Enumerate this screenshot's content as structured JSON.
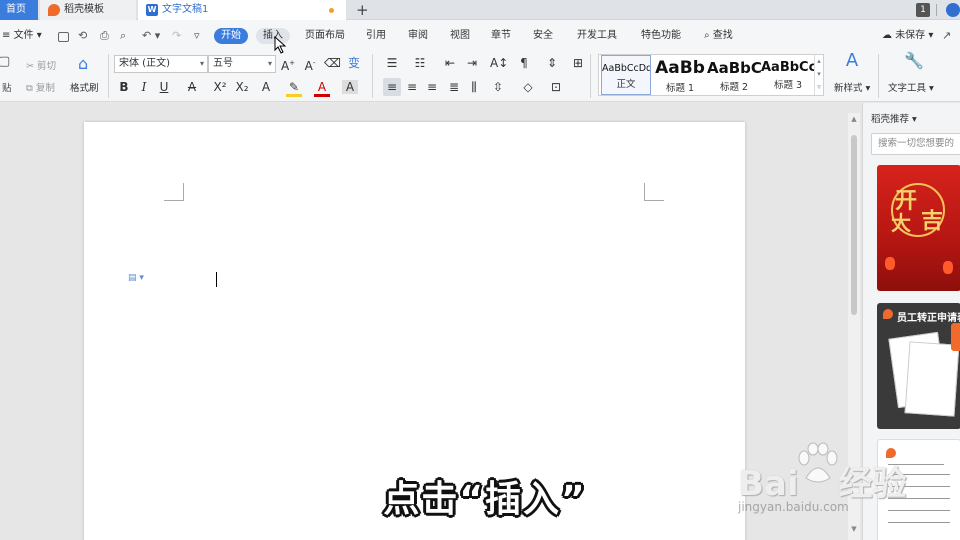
{
  "tabs": {
    "home": "首页",
    "templates": "稻壳模板",
    "document": "文字文稿1",
    "new_tab": "+",
    "window_badge": "1"
  },
  "menu": {
    "file": "文件",
    "items": [
      "开始",
      "插入",
      "页面布局",
      "引用",
      "审阅",
      "视图",
      "章节",
      "安全",
      "开发工具",
      "特色功能",
      "查找"
    ],
    "unsaved": "未保存"
  },
  "toolbar": {
    "paste": "贴",
    "cut": "剪切",
    "copy": "复制",
    "format_painter": "格式刷",
    "font_name": "宋体 (正文)",
    "font_size": "五号",
    "bold": "B",
    "italic": "I",
    "underline": "U",
    "new_style": "新样式",
    "text_tools": "文字工具"
  },
  "styles": [
    {
      "sample": "AaBbCcDd",
      "label": "正文"
    },
    {
      "sample": "AaBb",
      "label": "标题 1"
    },
    {
      "sample": "AaBbC",
      "label": "标题 2"
    },
    {
      "sample": "AaBbCc",
      "label": "标题 3"
    }
  ],
  "right_panel": {
    "title": "稻壳推荐",
    "search_placeholder": "搜索一切您想要的",
    "card1_text": [
      "开",
      "大",
      "吉"
    ],
    "card2_title": "员工转正申请表"
  },
  "caption": "点击“插入”",
  "watermark": {
    "brand": "Bai",
    "brand_suffix": "经验",
    "url": "jingyan.baidu.com"
  },
  "colors": {
    "accent": "#3b7ddd",
    "tab_bar": "#dfe3e8",
    "ribbon": "#f5f6f7",
    "canvas": "#e6e6e6"
  }
}
